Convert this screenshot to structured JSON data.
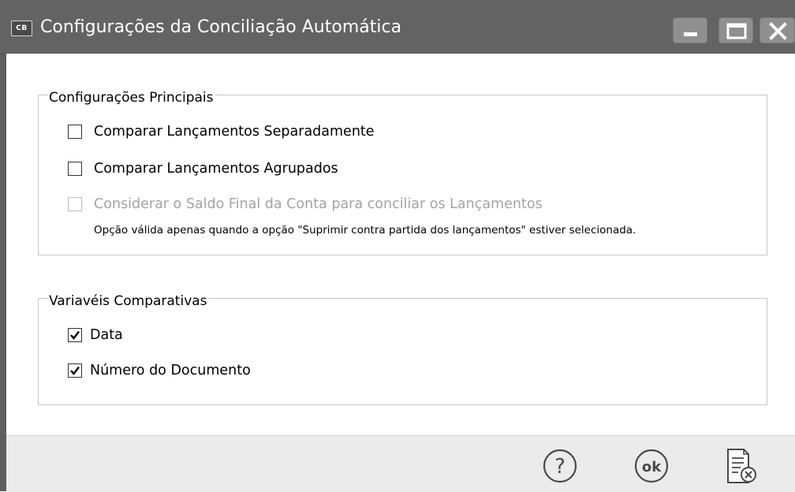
{
  "window": {
    "title": "Configurações da Conciliação Automática",
    "app_icon_text": "CB",
    "title_bar_color": "#636363"
  },
  "controls": {
    "minimize_icon": "minimize-icon",
    "maximize_icon": "maximize-icon",
    "close_icon": "close-icon"
  },
  "main_settings": {
    "title": "Configurações Principais",
    "options": [
      {
        "label": "Comparar Lançamentos Separadamente",
        "checked": false,
        "enabled": true
      },
      {
        "label": "Comparar Lançamentos Agrupados",
        "checked": false,
        "enabled": true
      },
      {
        "label": "Considerar o Saldo Final da Conta para conciliar os Lançamentos",
        "checked": false,
        "enabled": false
      }
    ],
    "note": "Opção válida apenas quando a opção \"Suprimir contra partida dos lançamentos\" estiver selecionada."
  },
  "comparative_variables": {
    "title": "Variavéis Comparativas",
    "options": [
      {
        "label": "Data",
        "checked": true
      },
      {
        "label": "Número do Documento",
        "checked": true
      }
    ]
  },
  "footer": {
    "help_icon": "help-icon",
    "ok_label": "ok",
    "cancel_icon": "cancel-document-icon"
  }
}
